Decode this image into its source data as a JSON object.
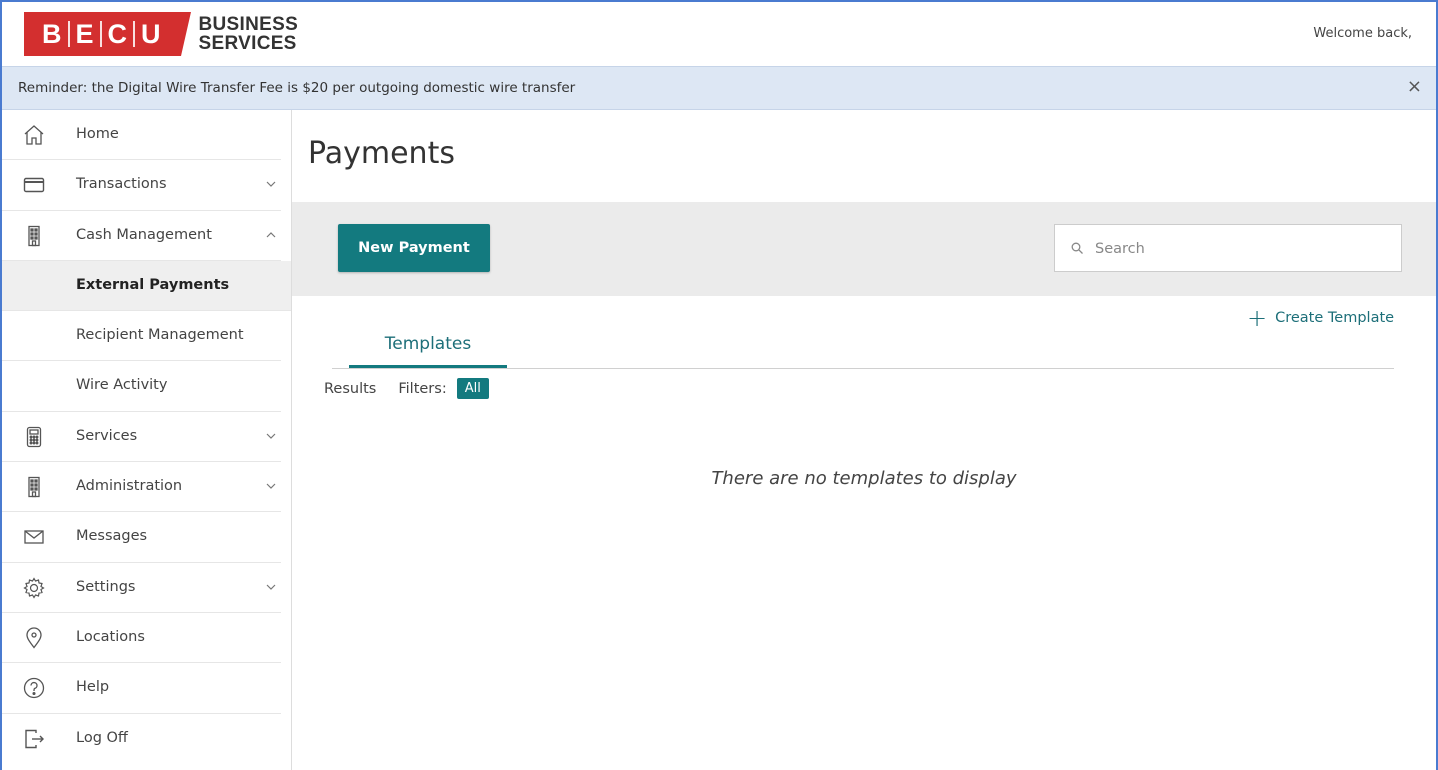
{
  "header": {
    "logo_letters": [
      "B",
      "E",
      "C",
      "U"
    ],
    "logo_line1": "BUSINESS",
    "logo_line2": "SERVICES",
    "welcome": "Welcome back,"
  },
  "banner": {
    "text": "Reminder: the Digital Wire Transfer Fee is $20 per outgoing domestic wire transfer",
    "close": "×"
  },
  "sidebar": {
    "items": [
      {
        "label": "Home",
        "icon": "home-icon"
      },
      {
        "label": "Transactions",
        "icon": "card-icon",
        "chevron": "down"
      },
      {
        "label": "Cash Management",
        "icon": "building-icon",
        "chevron": "up"
      },
      {
        "label": "External Payments",
        "sub": true,
        "active": true
      },
      {
        "label": "Recipient Management",
        "sub": true
      },
      {
        "label": "Wire Activity",
        "sub": true
      },
      {
        "label": "Services",
        "icon": "calculator-icon",
        "chevron": "down"
      },
      {
        "label": "Administration",
        "icon": "building-icon",
        "chevron": "down"
      },
      {
        "label": "Messages",
        "icon": "envelope-icon"
      },
      {
        "label": "Settings",
        "icon": "gear-icon",
        "chevron": "down"
      },
      {
        "label": "Locations",
        "icon": "location-pin-icon"
      },
      {
        "label": "Help",
        "icon": "help-icon"
      },
      {
        "label": "Log Off",
        "icon": "logout-icon"
      }
    ]
  },
  "main": {
    "title": "Payments",
    "new_payment_label": "New Payment",
    "search_placeholder": "Search",
    "create_template_label": "Create Template",
    "tab_templates": "Templates",
    "results_label": "Results",
    "filters_label": "Filters:",
    "filter_all": "All",
    "empty_message": "There are no templates to display"
  },
  "colors": {
    "brand_red": "#d32f2f",
    "teal": "#137a7f",
    "banner_bg": "#dde7f4"
  }
}
